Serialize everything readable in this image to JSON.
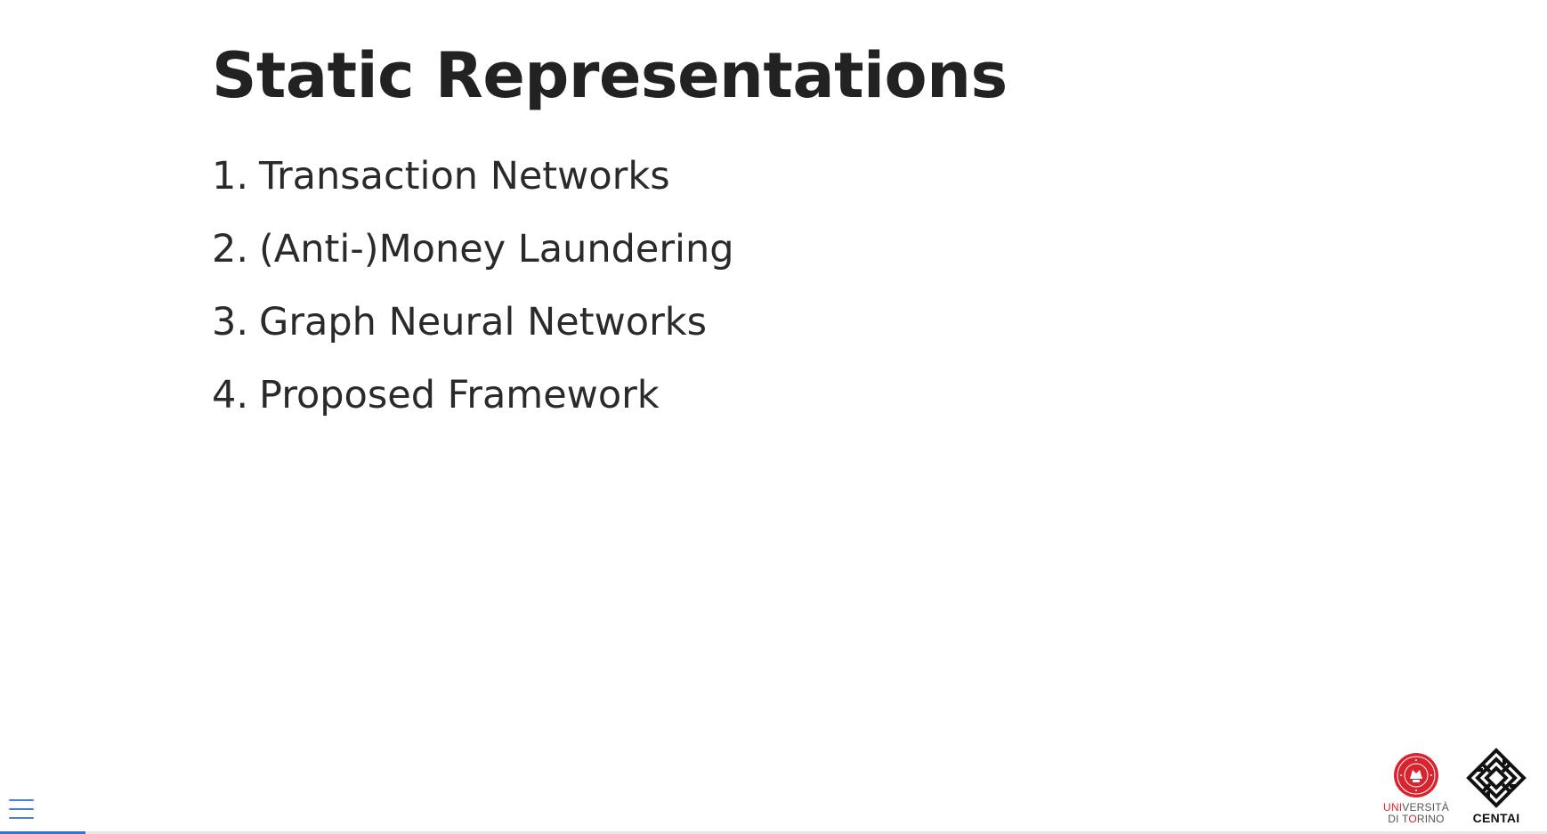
{
  "slide": {
    "title": "Static Representations",
    "items": [
      {
        "number": "1.",
        "label": "Transaction Networks"
      },
      {
        "number": "2.",
        "label": "(Anti-)Money Laundering"
      },
      {
        "number": "3.",
        "label": "Graph Neural Networks"
      },
      {
        "number": "4.",
        "label": "Proposed Framework"
      }
    ]
  },
  "controls": {
    "menu_icon": "hamburger-menu-icon",
    "accent_color": "#2a76dd",
    "progress_fraction": 0.055
  },
  "logos": {
    "unito": {
      "line1_red": "UNI",
      "line1_rest": "VERSITÀ",
      "line2_start": "DI T",
      "line2_red": "O",
      "line2_rest": "RINO",
      "color": "#d8242f"
    },
    "centai": {
      "text": "CENTAI"
    }
  }
}
